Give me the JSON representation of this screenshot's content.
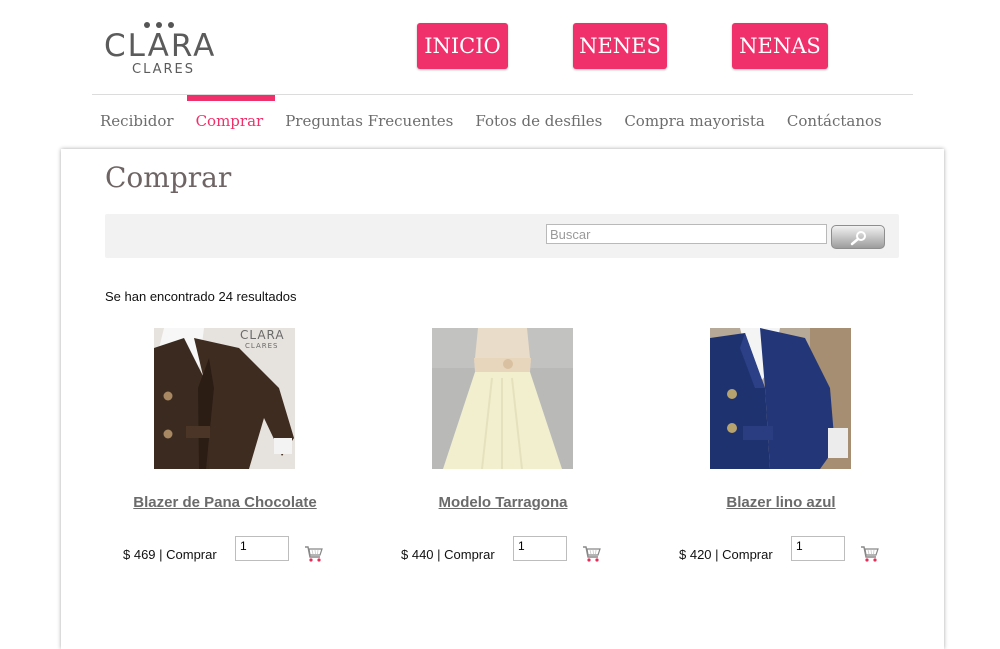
{
  "logo": {
    "line1": "CLARA",
    "line2": "CLARES"
  },
  "top_nav": {
    "inicio": "INICIO",
    "nenes": "NENES",
    "nenas": "NENAS"
  },
  "menu": {
    "items": [
      {
        "label": "Recibidor",
        "active": false
      },
      {
        "label": "Comprar",
        "active": true
      },
      {
        "label": "Preguntas Frecuentes",
        "active": false
      },
      {
        "label": "Fotos de desfiles",
        "active": false
      },
      {
        "label": "Compra mayorista",
        "active": false
      },
      {
        "label": "Contáctanos",
        "active": false
      }
    ]
  },
  "page": {
    "title": "Comprar"
  },
  "search": {
    "placeholder": "Buscar",
    "value": "",
    "button_icon": "magnifier-icon"
  },
  "results_text": "Se han encontrado 24 resultados",
  "products": [
    {
      "name": "Blazer de Pana Chocolate",
      "price": "$ 469 | Comprar",
      "qty": "1",
      "thumb_label": "CLARA",
      "thumb_label2": "CLARES"
    },
    {
      "name": "Modelo Tarragona",
      "price": "$ 440 | Comprar",
      "qty": "1"
    },
    {
      "name": "Blazer lino azul",
      "price": "$ 420 | Comprar",
      "qty": "1"
    }
  ],
  "colors": {
    "accent": "#f0306a",
    "title": "#6e6464",
    "menu_text": "#6d6d6d",
    "search_bg": "#f2f2f2"
  }
}
